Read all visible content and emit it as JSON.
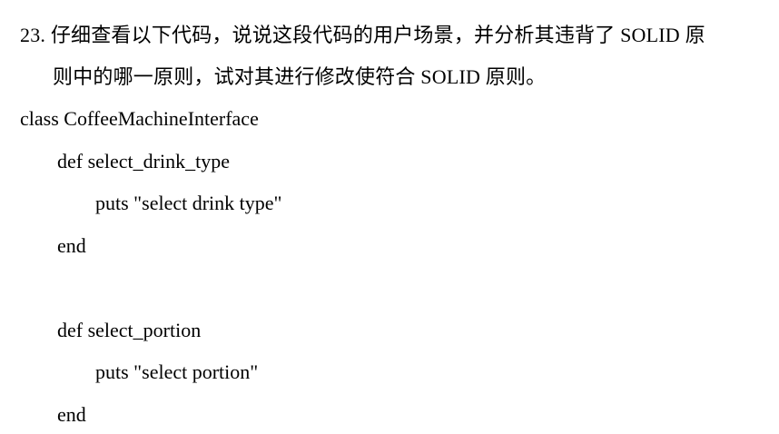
{
  "question": {
    "number": "23.",
    "line1": "仔细查看以下代码，说说这段代码的用户场景，并分析其违背了 SOLID 原",
    "line2": "则中的哪一原则，试对其进行修改使符合 SOLID 原则。"
  },
  "code": {
    "lines": [
      "class CoffeeMachineInterface",
      "def select_drink_type",
      "puts \"select drink type\"",
      "end",
      "def select_portion",
      "puts \"select portion\"",
      "end"
    ]
  }
}
